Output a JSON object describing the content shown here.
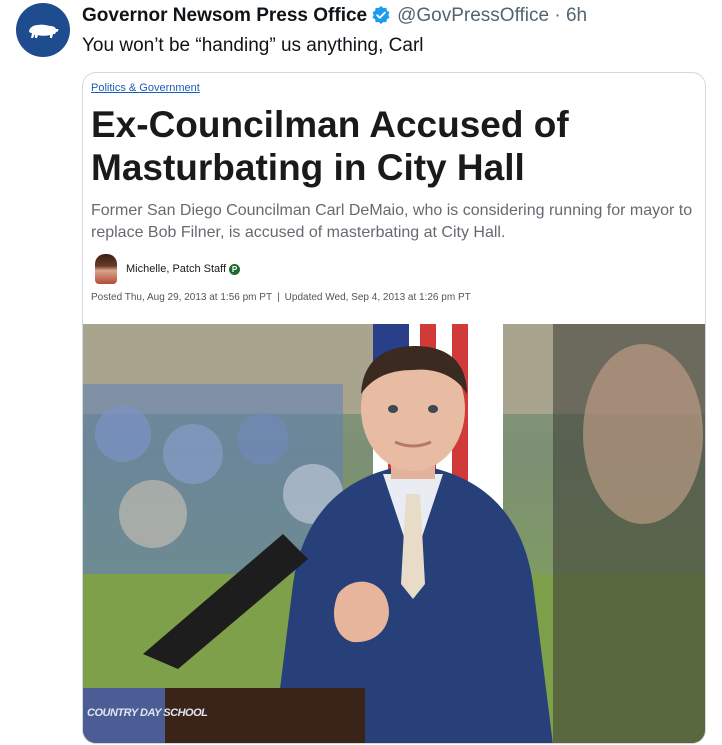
{
  "tweet": {
    "author": "Governor Newsom Press Office",
    "handle": "@GovPressOffice",
    "separator": "·",
    "time": "6h",
    "text": "You won’t be “handing” us anything, Carl"
  },
  "card": {
    "category": "Politics & Government",
    "headline": "Ex-Councilman Accused of Masturbating in City Hall",
    "dek": "Former San Diego Councilman Carl DeMaio, who is considering running for mayor to replace Bob Filner, is accused of masterbating at City Hall.",
    "author_name": "Michelle, Patch Staff",
    "badge": "P",
    "posted": "Posted Thu, Aug 29, 2013 at 1:56 pm PT",
    "meta_separator": "|",
    "updated": "Updated Wed, Sep 4, 2013 at 1:26 pm PT",
    "podium_text": "COUNTRY DAY SCHOOL"
  },
  "colors": {
    "avatar_bg": "#1f4b8f",
    "verified": "#1d9bf0",
    "link": "#1a5fb4"
  },
  "icons": [
    "california-bear-icon",
    "verified-badge-icon"
  ]
}
